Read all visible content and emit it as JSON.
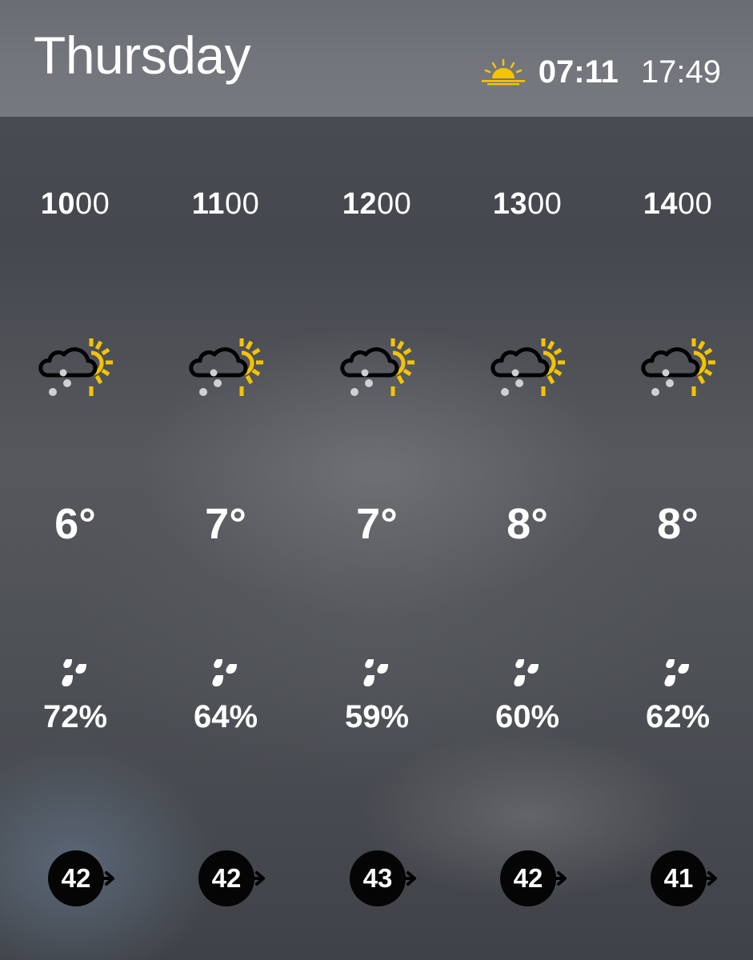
{
  "header": {
    "day": "Thursday",
    "sunrise_icon": "sunrise-icon",
    "sunrise": "07:11",
    "sunset": "17:49"
  },
  "colors": {
    "sun_yellow": "#f5c400",
    "cloud_outline": "#000000",
    "snow_dot": "#d0d0d0",
    "wind_badge": "#050505"
  },
  "hours": [
    {
      "time_bold": "10",
      "time_rest": "00",
      "icon": "sunny-intervals-sleet-icon",
      "temp": "6°",
      "precip_icon": "raindrops-icon",
      "precip": "72%",
      "wind_speed": "42",
      "wind_icon": "wind-direction-arrow-icon"
    },
    {
      "time_bold": "11",
      "time_rest": "00",
      "icon": "sunny-intervals-sleet-icon",
      "temp": "7°",
      "precip_icon": "raindrops-icon",
      "precip": "64%",
      "wind_speed": "42",
      "wind_icon": "wind-direction-arrow-icon"
    },
    {
      "time_bold": "12",
      "time_rest": "00",
      "icon": "sunny-intervals-sleet-icon",
      "temp": "7°",
      "precip_icon": "raindrops-icon",
      "precip": "59%",
      "wind_speed": "43",
      "wind_icon": "wind-direction-arrow-icon"
    },
    {
      "time_bold": "13",
      "time_rest": "00",
      "icon": "sunny-intervals-sleet-icon",
      "temp": "8°",
      "precip_icon": "raindrops-icon",
      "precip": "60%",
      "wind_speed": "42",
      "wind_icon": "wind-direction-arrow-icon"
    },
    {
      "time_bold": "14",
      "time_rest": "00",
      "icon": "sunny-intervals-sleet-icon",
      "temp": "8°",
      "precip_icon": "raindrops-icon",
      "precip": "62%",
      "wind_speed": "41",
      "wind_icon": "wind-direction-arrow-icon"
    }
  ]
}
